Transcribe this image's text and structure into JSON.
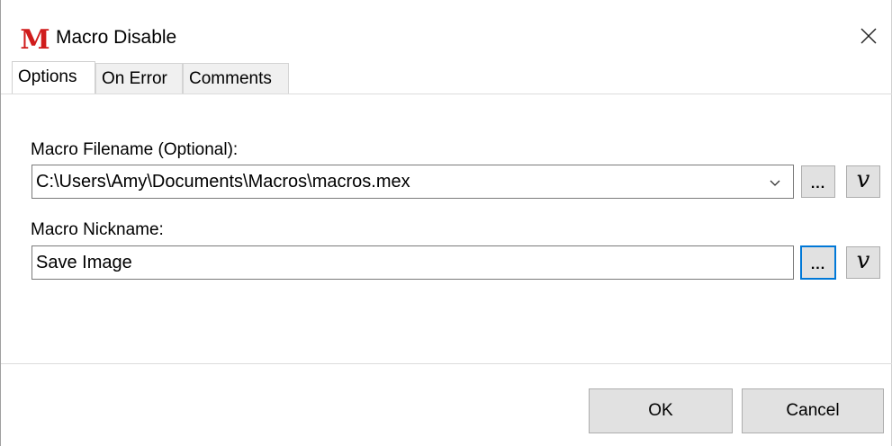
{
  "window": {
    "title": "Macro Disable",
    "app_icon_letter": "M",
    "close_symbol": "✕"
  },
  "tabs": [
    {
      "label": "Options",
      "active": true
    },
    {
      "label": "On Error",
      "active": false
    },
    {
      "label": "Comments",
      "active": false
    }
  ],
  "form": {
    "filename_label": "Macro Filename (Optional):",
    "filename_value": "C:\\Users\\Amy\\Documents\\Macros\\macros.mex",
    "nickname_label": "Macro Nickname:",
    "nickname_value": "Save Image",
    "browse_label": "...",
    "variable_label": "v"
  },
  "buttons": {
    "ok": "OK",
    "cancel": "Cancel"
  },
  "colors": {
    "icon_red": "#d01c1c",
    "focus_blue": "#0078d7",
    "button_face": "#e1e1e1"
  }
}
